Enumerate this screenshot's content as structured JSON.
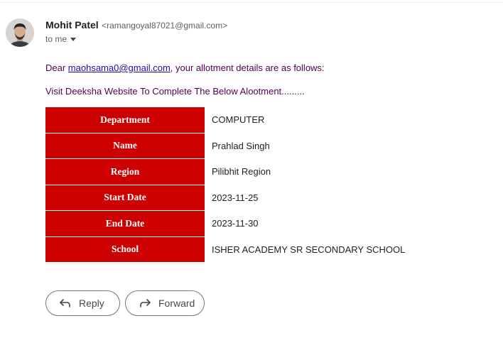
{
  "email": {
    "sender_name": "Mohit Patel",
    "sender_email": "<ramangoyal87021@gmail.com>",
    "to_label": "to me",
    "greeting_prefix": "Dear ",
    "greeting_link": "maohsama0@gmail.com",
    "greeting_suffix": ", your allotment details are as follows:",
    "intro": "Visit Deeksha Website To Complete The Below Alootment........."
  },
  "details": [
    {
      "label": "Department",
      "value": "COMPUTER"
    },
    {
      "label": "Name",
      "value": "Prahlad Singh"
    },
    {
      "label": "Region",
      "value": "Pilibhit Region"
    },
    {
      "label": "Start Date",
      "value": "2023-11-25"
    },
    {
      "label": "End Date",
      "value": "2023-11-30"
    },
    {
      "label": "School",
      "value": "ISHER ACADEMY SR SECONDARY SCHOOL"
    }
  ],
  "actions": {
    "reply_label": "Reply",
    "forward_label": "Forward"
  },
  "colors": {
    "label_bg": "#cc0000",
    "link": "#1a0dab",
    "body_text": "#500050"
  },
  "icons": {
    "reply": "reply-arrow-icon",
    "forward": "forward-arrow-icon",
    "to_dropdown": "caret-down-icon"
  }
}
